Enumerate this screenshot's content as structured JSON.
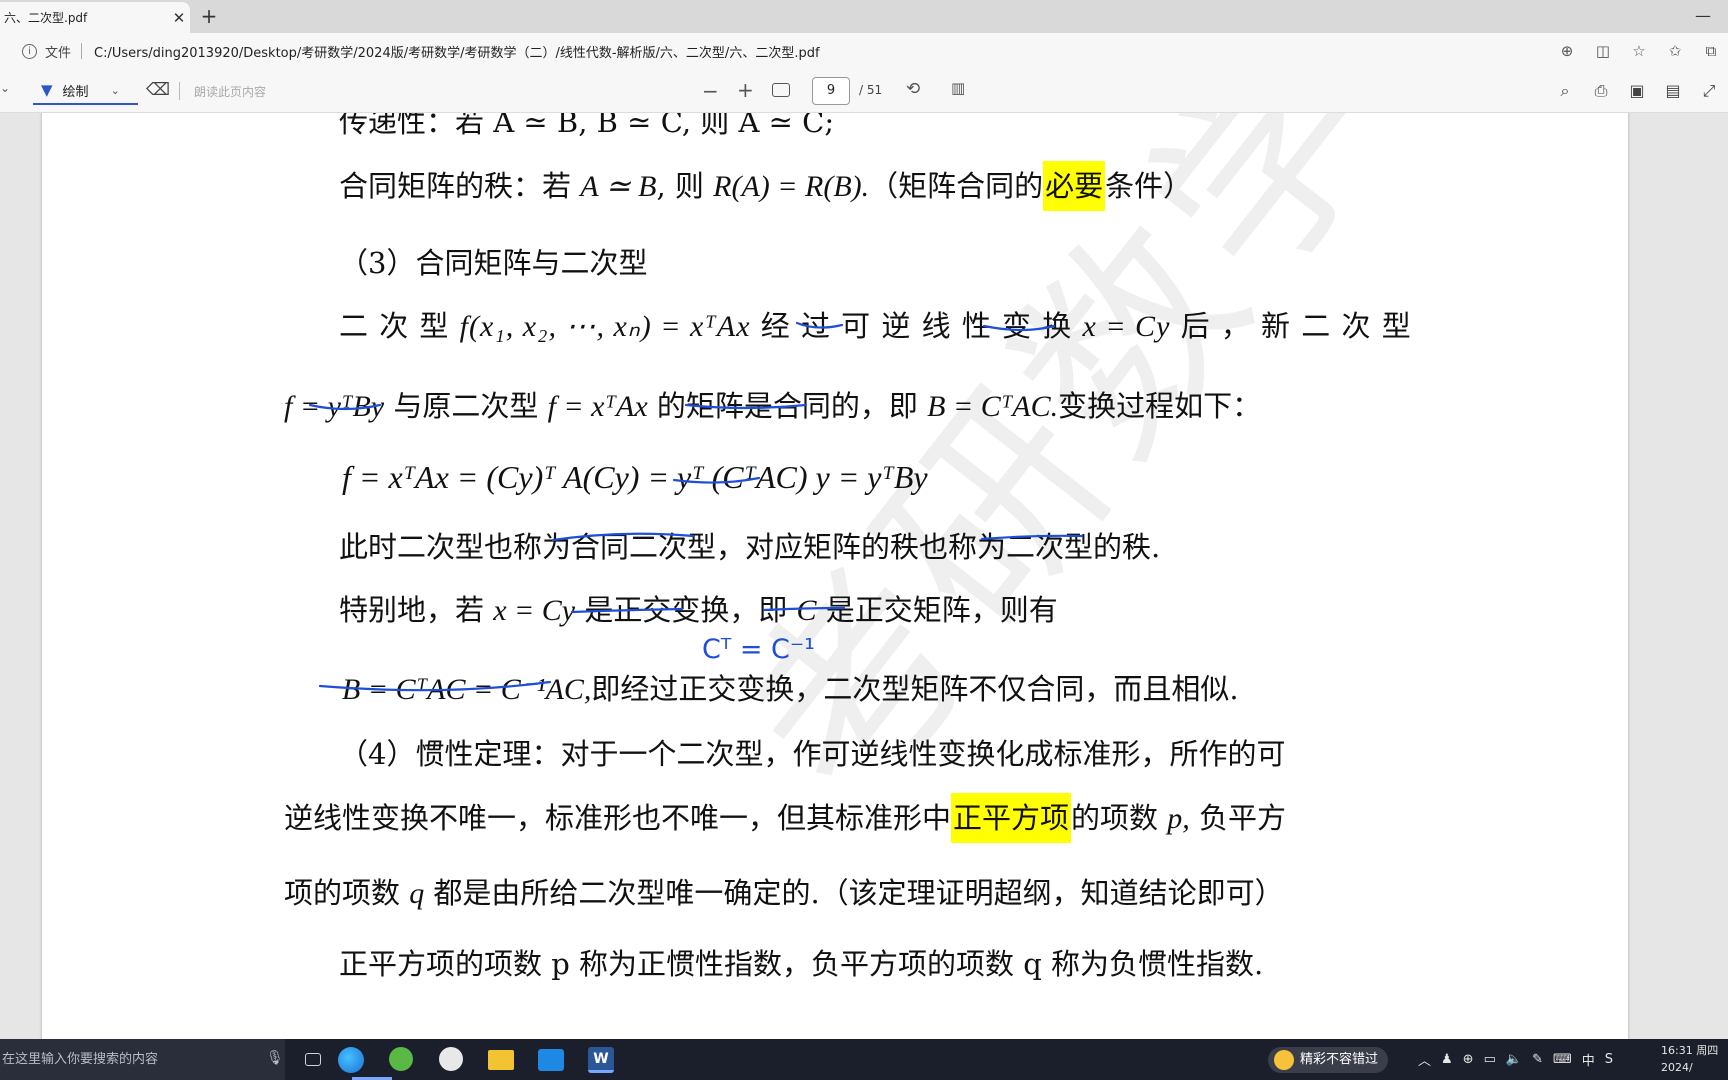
{
  "browser": {
    "tab_title": "六、二次型.pdf",
    "tab_close": "✕",
    "new_tab": "+",
    "file_label": "文件",
    "url": "C:/Users/ding2013920/Desktop/考研数学/2024版/考研数学/考研数学（二）/线性代数-解析版/六、二次型/六、二次型.pdf",
    "minimize": "—"
  },
  "pdf_toolbar": {
    "draw_label": "绘制",
    "read_aloud_label": "朗读此页内容",
    "current_page": "9",
    "total_pages": "/ 51",
    "zoom_out": "−",
    "zoom_in": "+"
  },
  "document": {
    "line_top": "传递性：若 A ≃ B, B ≃ C, 则 A ≃ C;",
    "rank_prefix": "合同矩阵的秩：若 ",
    "rank_math": "A ≃ B",
    "rank_mid": ", 则 ",
    "rank_math2": "R(A) = R(B).",
    "rank_suffix_a": "（矩阵合同的",
    "rank_highlight": "必要",
    "rank_suffix_b": "条件）",
    "section3_title": "（3）合同矩阵与二次型",
    "p1_a": "二 次 型 ",
    "p1_math1": "f(x₁, x₂, ⋯, xₙ) = xᵀAx",
    "p1_b": " 经 过 可 逆 线 性 变 换 ",
    "p1_math2": "x = Cy",
    "p1_c": " 后 ， 新 二 次 型",
    "p2_math1": "f = yᵀBy",
    "p2_a": " 与原二次型 ",
    "p2_math2": "f = xᵀAx",
    "p2_b": " 的矩阵是合同的，即 ",
    "p2_math3": "B = CᵀAC.",
    "p2_c": "变换过程如下：",
    "eq1": "f = xᵀAx = (Cy)ᵀ A(Cy) = yᵀ (CᵀAC) y = yᵀBy",
    "p3": "此时二次型也称为合同二次型，对应矩阵的秩也称为二次型的秩.",
    "p4_a": "特别地，若 ",
    "p4_math": "x = Cy",
    "p4_b": " 是正交变换，即 ",
    "p4_math2": "C",
    "p4_c": " 是正交矩阵，则有",
    "handwritten": "Cᵀ = C⁻¹",
    "p5_math": "B = CᵀAC = C⁻¹AC,",
    "p5_text": "即经过正交变换，二次型矩阵不仅合同，而且相似.",
    "p6": "（4）惯性定理：对于一个二次型，作可逆线性变换化成标准形，所作的可",
    "p7_a": "逆线性变换不唯一，标准形也不唯一，但其标准形中",
    "p7_highlight": "正平方项",
    "p7_b": "的项数 ",
    "p7_math": "p,",
    "p7_c": " 负平方",
    "p8_a": "项的项数 ",
    "p8_math": "q",
    "p8_b": " 都是由所给二次型唯一确定的.（该定理证明超纲，知道结论即可）",
    "p9_partial": "正平方项的项数 p 称为正惯性指数，负平方项的项数 q 称为负惯性指数.",
    "watermark": "考研数学丁哥华"
  },
  "taskbar": {
    "search_placeholder": "在这里输入你要搜索的内容",
    "notify_text": "精彩不容错过",
    "ime": "中",
    "time": "16:31 周四",
    "date": "2024/"
  },
  "colors": {
    "highlight": "#ffff00",
    "annotation_blue": "#1f4fd6",
    "accent": "#2b57c9"
  }
}
